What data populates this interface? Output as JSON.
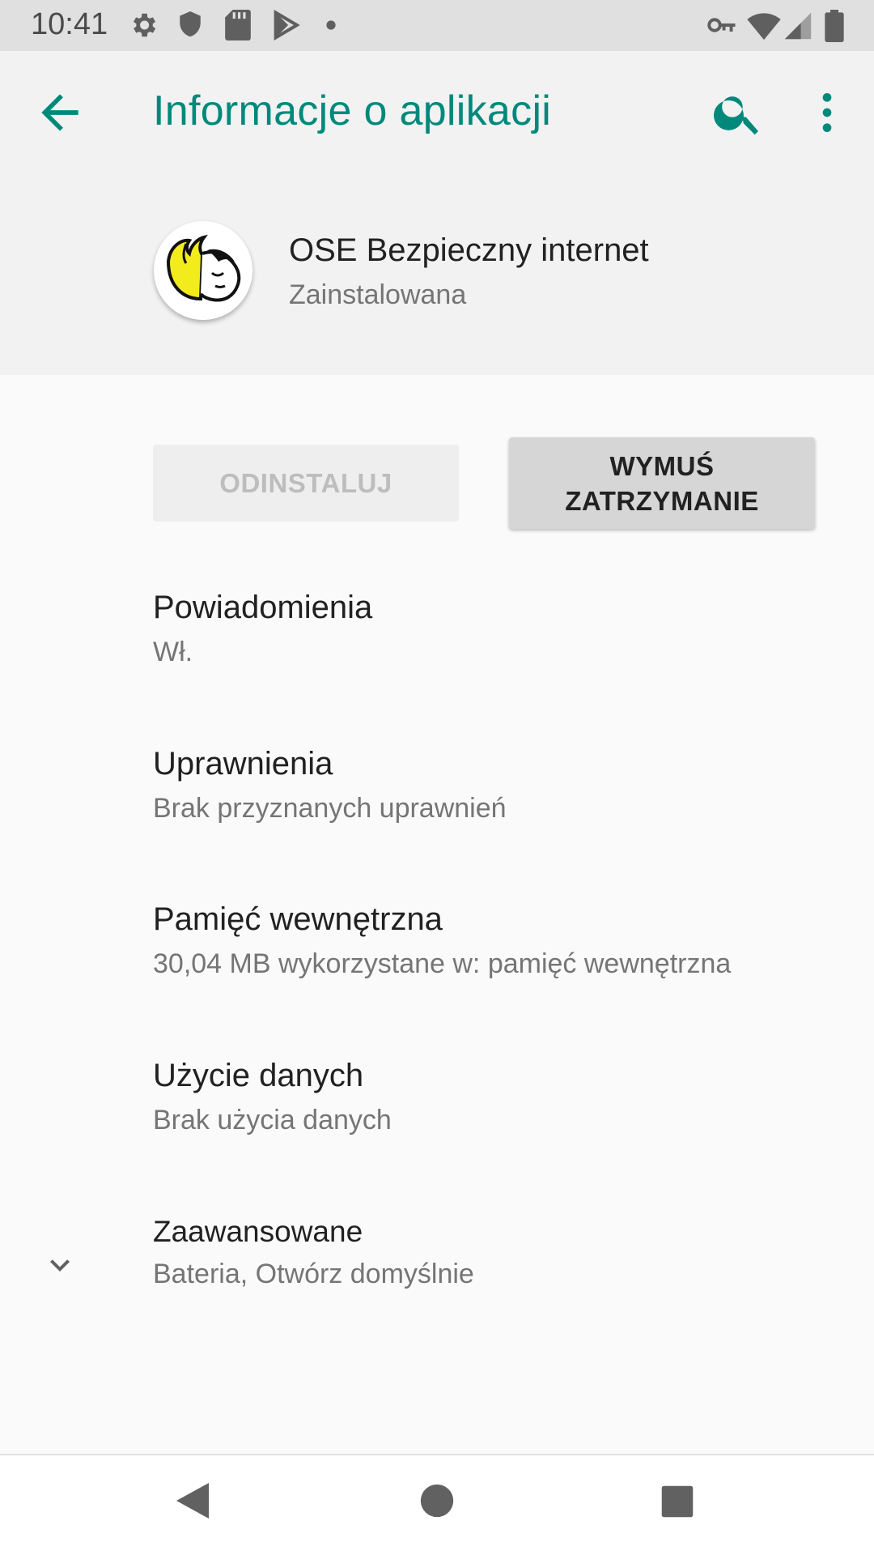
{
  "status_bar": {
    "time": "10:41",
    "icons_left": [
      "settings-gear-icon",
      "shield-icon",
      "sd-card-icon",
      "play-store-icon",
      "dot-icon"
    ],
    "icons_right": [
      "vpn-key-icon",
      "wifi-icon",
      "signal-icon",
      "battery-icon"
    ]
  },
  "app_bar": {
    "title": "Informacje o aplikacji",
    "accent_color": "#00897b",
    "actions": [
      "search-icon",
      "more-vert-icon"
    ]
  },
  "app_header": {
    "name": "OSE Bezpieczny internet",
    "status": "Zainstalowana"
  },
  "buttons": {
    "uninstall": "ODINSTALUJ",
    "force_stop_line1": "WYMUŚ",
    "force_stop_line2": "ZATRZYMANIE"
  },
  "preferences": [
    {
      "title": "Powiadomienia",
      "summary": "Wł."
    },
    {
      "title": "Uprawnienia",
      "summary": "Brak przyznanych uprawnień"
    },
    {
      "title": "Pamięć wewnętrzna",
      "summary": "30,04 MB wykorzystane w: pamięć wewnętrzna"
    },
    {
      "title": "Użycie danych",
      "summary": "Brak użycia danych"
    },
    {
      "title": "Zaawansowane",
      "summary": "Bateria, Otwórz domyślnie"
    }
  ],
  "nav_bar": {
    "buttons": [
      "back-triangle-icon",
      "home-circle-icon",
      "recents-square-icon"
    ]
  }
}
